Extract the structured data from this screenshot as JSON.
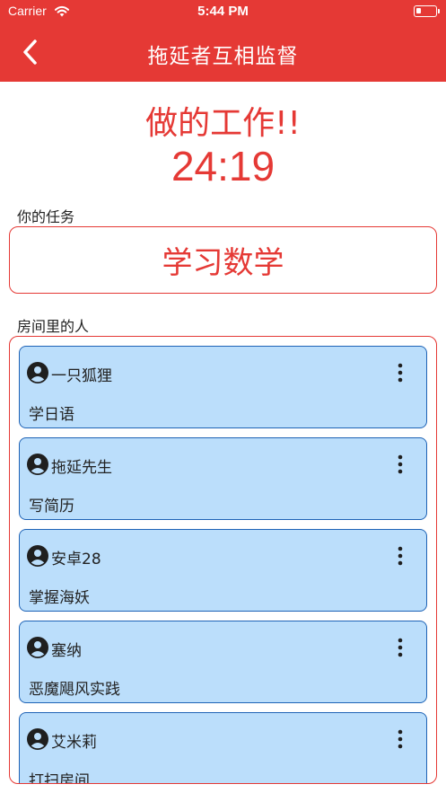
{
  "status_bar": {
    "carrier": "Carrier",
    "time": "5:44 PM"
  },
  "app_bar": {
    "title": "拖延者互相监督",
    "back_icon": "chevron-left-icon"
  },
  "main": {
    "heading": "做的工作!!",
    "timer": "24:19",
    "your_task_label": "你的任务",
    "your_task": "学习数学",
    "room_label": "房间里的人"
  },
  "people": [
    {
      "name": "一只狐狸",
      "task": "学日语"
    },
    {
      "name": "拖延先生",
      "task": "写简历"
    },
    {
      "name": "安卓28",
      "task": "掌握海妖"
    },
    {
      "name": "塞纳",
      "task": "恶魔飓风实践"
    },
    {
      "name": "艾米莉",
      "task": "打扫房间"
    }
  ],
  "colors": {
    "accent": "#e53935",
    "card_bg": "#bbdefb",
    "card_border": "#1e63b6"
  }
}
